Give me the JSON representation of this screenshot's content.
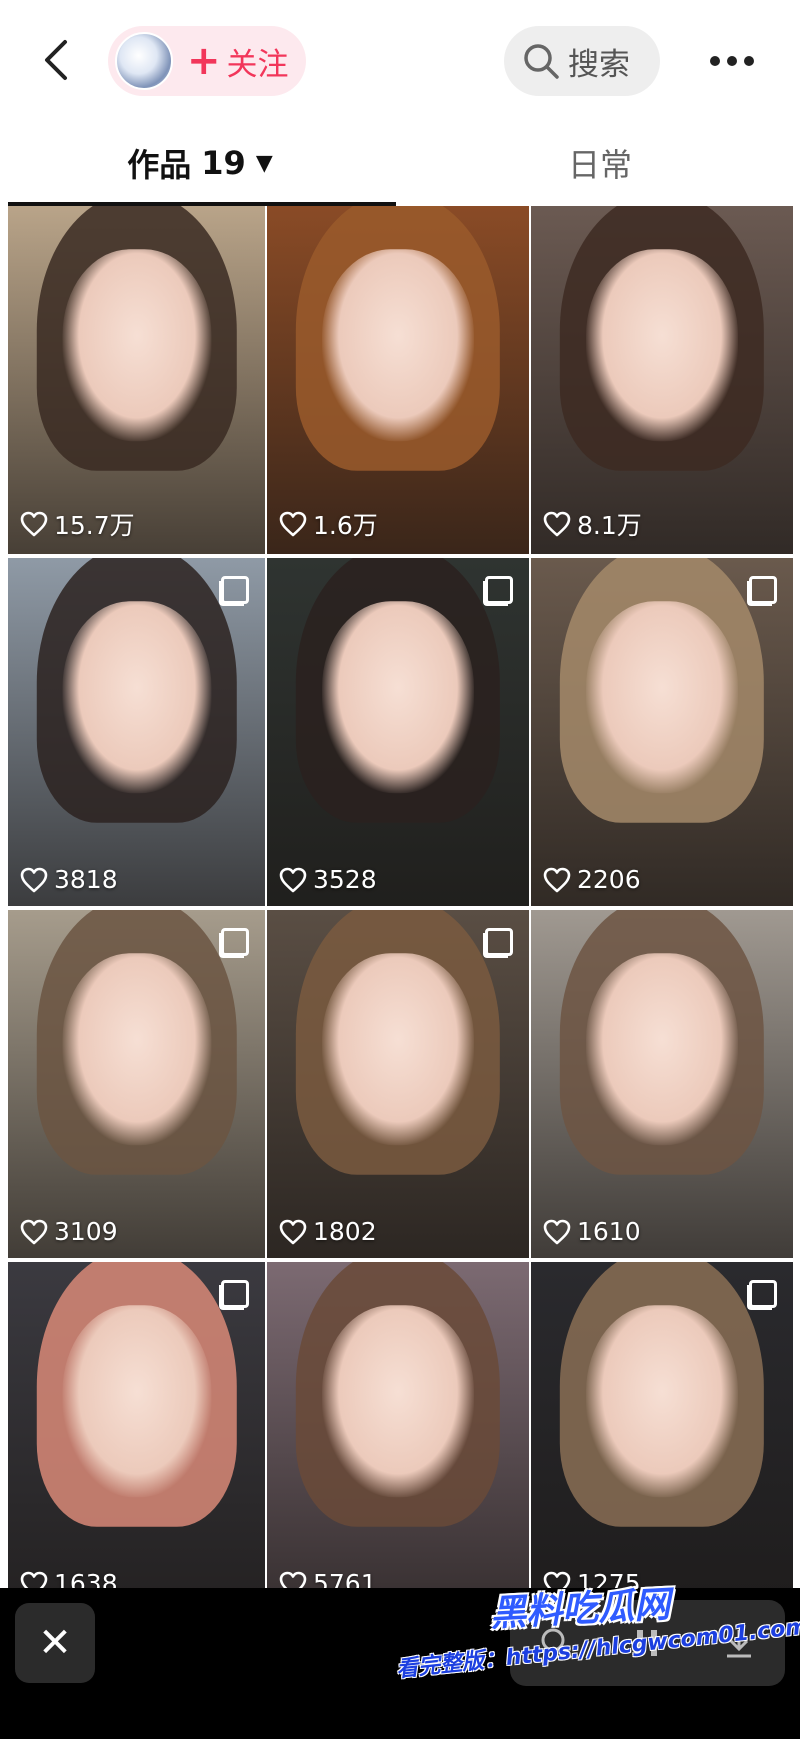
{
  "header": {
    "back_icon": "chevron-left-icon",
    "follow_label": "关注",
    "follow_icon": "plus-icon",
    "follow_color": "#f2365a",
    "search_label": "搜索",
    "search_icon": "search-icon",
    "more_icon": "more-dots-icon"
  },
  "tabs": {
    "works_label": "作品",
    "works_count": "19",
    "works_caret": "▼",
    "daily_label": "日常"
  },
  "grid": {
    "items": [
      {
        "likes": "15.7万",
        "multi": false,
        "hair": "#3a2a22",
        "bg": "#b9a489"
      },
      {
        "likes": "1.6万",
        "multi": false,
        "hair": "#9a5a2c",
        "bg": "#8a4b26"
      },
      {
        "likes": "8.1万",
        "multi": false,
        "hair": "#3d2a22",
        "bg": "#6b5a52"
      },
      {
        "likes": "3818",
        "multi": true,
        "hair": "#2b2220",
        "bg": "#8f9aa6"
      },
      {
        "likes": "3528",
        "multi": true,
        "hair": "#2a211e",
        "bg": "#2f3431"
      },
      {
        "likes": "2206",
        "multi": true,
        "hair": "#a48a6a",
        "bg": "#6a5a4d"
      },
      {
        "likes": "3109",
        "multi": true,
        "hair": "#6b5542",
        "bg": "#a69c8c"
      },
      {
        "likes": "1802",
        "multi": true,
        "hair": "#7a5a40",
        "bg": "#5a4e44"
      },
      {
        "likes": "1610",
        "multi": false,
        "hair": "#6d5543",
        "bg": "#a09991"
      },
      {
        "likes": "1638",
        "multi": true,
        "hair": "#d98a78",
        "bg": "#3b3a40"
      },
      {
        "likes": "5761",
        "multi": false,
        "hair": "#6a4a38",
        "bg": "#7c6a72"
      },
      {
        "likes": "1275",
        "multi": true,
        "hair": "#8a6f55",
        "bg": "#2a2a2e"
      }
    ]
  },
  "bottom": {
    "close_label": "✕",
    "close_icon": "close-icon"
  },
  "watermark": {
    "brand": "黑料吃瓜网",
    "url_prefix": "看完整版：",
    "url": "https://hlcgwcom01.com"
  }
}
